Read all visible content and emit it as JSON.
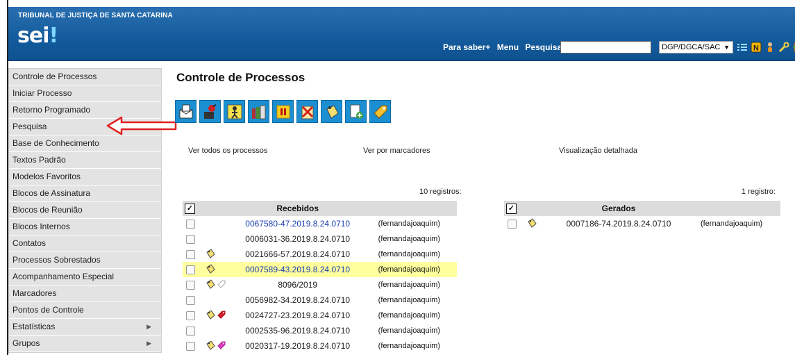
{
  "header": {
    "org_name": "TRIBUNAL DE JUSTIÇA DE SANTA CATARINA",
    "logo_text": "sei",
    "logo_mark": "!",
    "link_para_saber": "Para saber+",
    "link_menu": "Menu",
    "link_pesquisa": "Pesquisa",
    "search_value": "",
    "unit_selected": "DGP/DGCA/SAC",
    "icons": [
      "list-icon",
      "note-n-icon",
      "user-icon",
      "tools-icon",
      "exit-icon"
    ]
  },
  "sidebar": {
    "items": [
      {
        "label": "Controle de Processos",
        "submenu": false
      },
      {
        "label": "Iniciar Processo",
        "submenu": false
      },
      {
        "label": "Retorno Programado",
        "submenu": false
      },
      {
        "label": "Pesquisa",
        "submenu": false
      },
      {
        "label": "Base de Conhecimento",
        "submenu": false
      },
      {
        "label": "Textos Padrão",
        "submenu": false
      },
      {
        "label": "Modelos Favoritos",
        "submenu": false
      },
      {
        "label": "Blocos de Assinatura",
        "submenu": false
      },
      {
        "label": "Blocos de Reunião",
        "submenu": false
      },
      {
        "label": "Blocos Internos",
        "submenu": false
      },
      {
        "label": "Contatos",
        "submenu": false
      },
      {
        "label": "Processos Sobrestados",
        "submenu": false
      },
      {
        "label": "Acompanhamento Especial",
        "submenu": false
      },
      {
        "label": "Marcadores",
        "submenu": false
      },
      {
        "label": "Pontos de Controle",
        "submenu": false
      },
      {
        "label": "Estatísticas",
        "submenu": true
      },
      {
        "label": "Grupos",
        "submenu": true
      }
    ]
  },
  "main": {
    "title": "Controle de Processos",
    "toolbar_icons": [
      "send-process-icon",
      "update-progress-icon",
      "assign-process-icon",
      "sobrestar-icon",
      "conclude-process-icon",
      "cancel-icon",
      "annotation-icon",
      "include-document-icon",
      "marker-icon"
    ],
    "view_links": {
      "all": "Ver todos os processos",
      "by_marker": "Ver por marcadores",
      "detailed": "Visualização detalhada"
    },
    "received": {
      "count_label": "10 registros:",
      "header": "Recebidos",
      "header_check": "✓",
      "rows": [
        {
          "process": "0067580-47.2019.8.24.0710",
          "user": "(fernandajoaquim)",
          "link": true,
          "icons": [],
          "highlight": false
        },
        {
          "process": "0006031-36.2019.8.24.0710",
          "user": "(fernandajoaquim)",
          "link": false,
          "icons": [],
          "highlight": false
        },
        {
          "process": "0021666-57.2019.8.24.0710",
          "user": "(fernandajoaquim)",
          "link": false,
          "icons": [
            "annotation-icon"
          ],
          "highlight": false
        },
        {
          "process": "0007589-43.2019.8.24.0710",
          "user": "(fernandajoaquim)",
          "link": true,
          "icons": [
            "annotation-icon"
          ],
          "highlight": true
        },
        {
          "process": "8096/2019",
          "user": "(fernandajoaquim)",
          "link": false,
          "icons": [
            "annotation-icon",
            "marker-empty-icon"
          ],
          "highlight": false
        },
        {
          "process": "0056982-34.2019.8.24.0710",
          "user": "(fernandajoaquim)",
          "link": false,
          "icons": [],
          "highlight": false
        },
        {
          "process": "0024727-23.2019.8.24.0710",
          "user": "(fernandajoaquim)",
          "link": false,
          "icons": [
            "annotation-icon",
            "marker-red-icon"
          ],
          "highlight": false
        },
        {
          "process": "0002535-96.2019.8.24.0710",
          "user": "(fernandajoaquim)",
          "link": false,
          "icons": [],
          "highlight": false
        },
        {
          "process": "0020317-19.2019.8.24.0710",
          "user": "(fernandajoaquim)",
          "link": false,
          "icons": [
            "annotation-icon",
            "marker-pink-icon"
          ],
          "highlight": false
        }
      ]
    },
    "generated": {
      "count_label": "1 registro:",
      "header": "Gerados",
      "header_check": "✓",
      "rows": [
        {
          "process": "0007186-74.2019.8.24.0710",
          "user": "(fernandajoaquim)",
          "link": false,
          "icons": [
            "annotation-icon"
          ],
          "highlight": false
        }
      ]
    }
  },
  "colors": {
    "header_blue": "#135b9c",
    "toolbar_blue": "#1b8fd1",
    "link_blue": "#1a3fb0",
    "highlight_yellow": "#ffff9e",
    "arrow_red": "#e02020"
  }
}
